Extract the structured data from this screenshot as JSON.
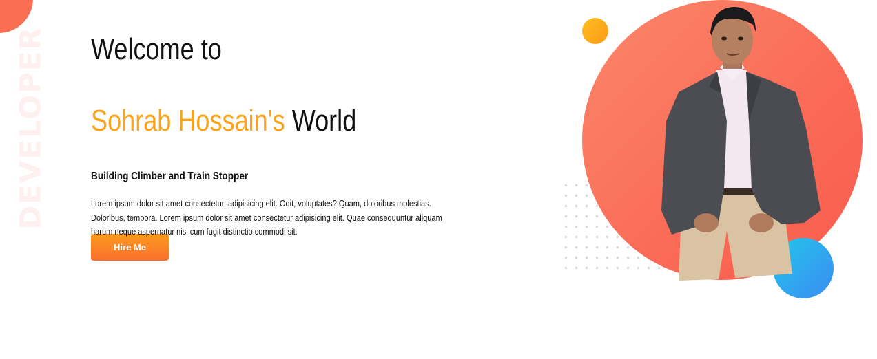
{
  "side_text": "DEVELOPER",
  "hero": {
    "welcome": "Welcome to",
    "name_highlight": "Sohrab Hossain's",
    "name_rest": "World",
    "tagline": "Building Climber and Train Stopper",
    "bio": "Lorem ipsum dolor sit amet consectetur, adipisicing elit. Odit, voluptates? Quam, doloribus molestias. Doloribus, tempora. Lorem ipsum dolor sit amet consectetur adipisicing elit. Quae consequuntur aliquam harum neque aspernatur nisi cum fugit distinctio commodi sit.",
    "cta_label": "Hire Me"
  },
  "colors": {
    "accent": "#fba31a",
    "circle": "#fa6e52",
    "button_gradient": [
      "#fb9a1c",
      "#fb6f2e"
    ],
    "blue_circle": "#2fa4ef"
  },
  "icons": {
    "portrait": "person-photo"
  }
}
